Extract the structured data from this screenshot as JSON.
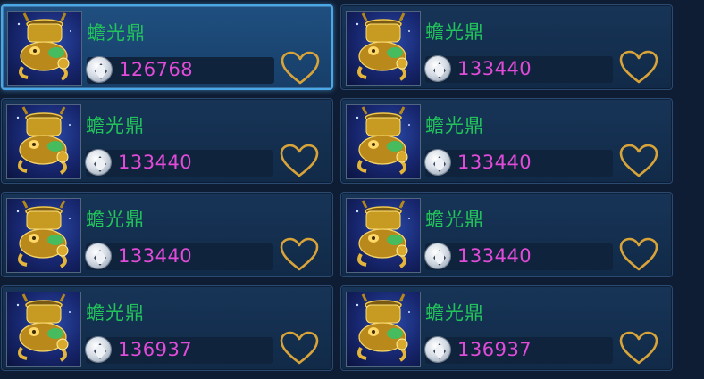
{
  "items": [
    {
      "name": "蟾光鼎",
      "price": "126768",
      "selected": true
    },
    {
      "name": "蟾光鼎",
      "price": "133440",
      "selected": false
    },
    {
      "name": "蟾光鼎",
      "price": "133440",
      "selected": false
    },
    {
      "name": "蟾光鼎",
      "price": "133440",
      "selected": false
    },
    {
      "name": "蟾光鼎",
      "price": "133440",
      "selected": false
    },
    {
      "name": "蟾光鼎",
      "price": "133440",
      "selected": false
    },
    {
      "name": "蟾光鼎",
      "price": "136937",
      "selected": false
    },
    {
      "name": "蟾光鼎",
      "price": "136937",
      "selected": false
    }
  ],
  "icons": {
    "currency": "silver-coin-icon",
    "favorite": "heart-outline-icon",
    "item_art": "golden-toad-cauldron-icon"
  },
  "colors": {
    "name": "#22c35a",
    "price": "#e04bd8",
    "heart": "#d8a43a",
    "selected_border": "#4ba8e6"
  }
}
